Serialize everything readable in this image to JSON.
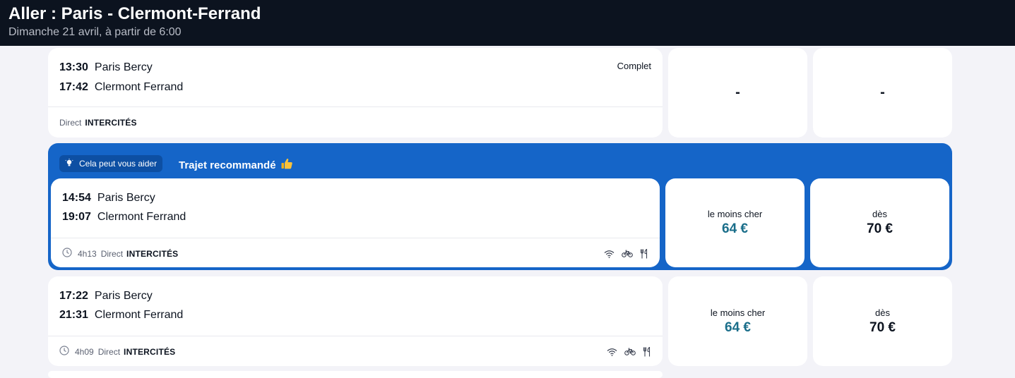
{
  "header": {
    "title": "Aller : Paris - Clermont-Ferrand",
    "subtitle": "Dimanche 21 avril, à partir de 6:00"
  },
  "trips": [
    {
      "departure_time": "13:30",
      "departure_station": "Paris Bercy",
      "arrival_time": "17:42",
      "arrival_station": "Clermont Ferrand",
      "status": "Complet",
      "type": "Direct",
      "carrier": "INTERCITÉS",
      "fare1": {
        "value": "-"
      },
      "fare2": {
        "value": "-"
      }
    },
    {
      "recommendation_badge": "Cela peut vous aider",
      "recommendation_title": "Trajet recommandé",
      "departure_time": "14:54",
      "departure_station": "Paris Bercy",
      "arrival_time": "19:07",
      "arrival_station": "Clermont Ferrand",
      "duration": "4h13",
      "type": "Direct",
      "carrier": "INTERCITÉS",
      "services": [
        "wifi-icon",
        "bike-icon",
        "restaurant-icon"
      ],
      "fare1": {
        "label": "le moins cher",
        "value": "64 €"
      },
      "fare2": {
        "label": "dès",
        "value": "70 €"
      }
    },
    {
      "departure_time": "17:22",
      "departure_station": "Paris Bercy",
      "arrival_time": "21:31",
      "arrival_station": "Clermont Ferrand",
      "duration": "4h09",
      "type": "Direct",
      "carrier": "INTERCITÉS",
      "services": [
        "wifi-icon",
        "bike-icon",
        "restaurant-icon"
      ],
      "fare1": {
        "label": "le moins cher",
        "value": "64 €"
      },
      "fare2": {
        "label": "dès",
        "value": "70 €"
      }
    }
  ],
  "colors": {
    "header_bg": "#0c131f",
    "recommend_bg": "#1565c8",
    "cheap_price": "#1a6e8a",
    "page_bg": "#f3f3f8"
  }
}
